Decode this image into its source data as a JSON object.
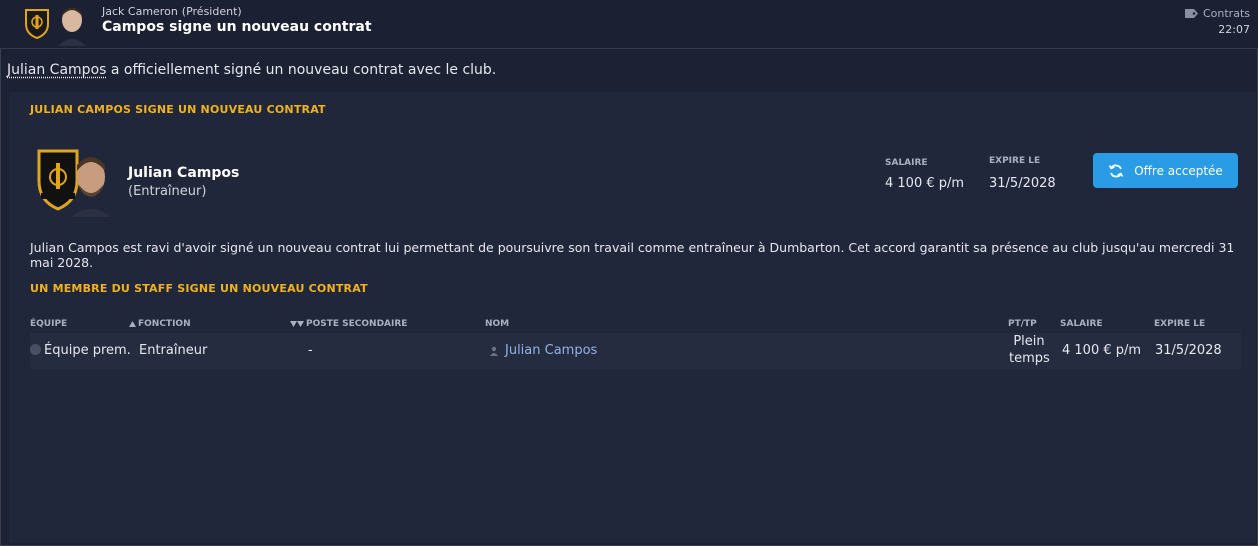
{
  "header": {
    "sender_name": "Jack Cameron",
    "sender_role": "(Président)",
    "subject": "Campos signe un nouveau contrat",
    "category": "Contrats",
    "time": "22:07"
  },
  "intro": {
    "player_link": "Julian Campos",
    "rest": " a officiellement signé un nouveau contrat avec le club."
  },
  "section1": {
    "title": "JULIAN CAMPOS SIGNE UN NOUVEAU CONTRAT",
    "person_name": "Julian Campos",
    "person_role": "(Entraîneur)",
    "salary_label": "SALAIRE",
    "salary_value": "4 100 € p/m",
    "expiry_label": "EXPIRE LE",
    "expiry_value": "31/5/2028",
    "button_label": "Offre acceptée",
    "description": "Julian Campos est ravi d'avoir signé un nouveau contrat lui permettant de poursuivre son travail comme entraîneur à Dumbarton. Cet accord garantit sa présence au club jusqu'au mercredi 31 mai 2028."
  },
  "section2": {
    "title": "UN MEMBRE DU STAFF SIGNE UN NOUVEAU CONTRAT",
    "columns": {
      "team": "ÉQUIPE",
      "function": "FONCTION",
      "secondary": "POSTE SECONDAIRE",
      "name": "NOM",
      "ptft": "PT/TP",
      "salary": "SALAIRE",
      "expiry": "EXPIRE LE"
    },
    "row": {
      "team": "Équipe prem.",
      "function": "Entraîneur",
      "secondary": "-",
      "name": "Julian Campos",
      "ptft_line1": "Plein",
      "ptft_line2": "temps",
      "salary": "4 100 € p/m",
      "expiry": "31/5/2028"
    }
  },
  "colors": {
    "background": "#1c2133",
    "panel": "#21273a",
    "accent_yellow": "#f2b21b",
    "button_blue": "#2a9ce6",
    "link_blue": "#8fb3e6"
  },
  "icons": [
    "club-badge-icon",
    "president-avatar",
    "tag-icon",
    "staff-avatar",
    "refresh-icon",
    "person-icon",
    "check-icon",
    "sort-up-icon",
    "sort-down-icon"
  ]
}
